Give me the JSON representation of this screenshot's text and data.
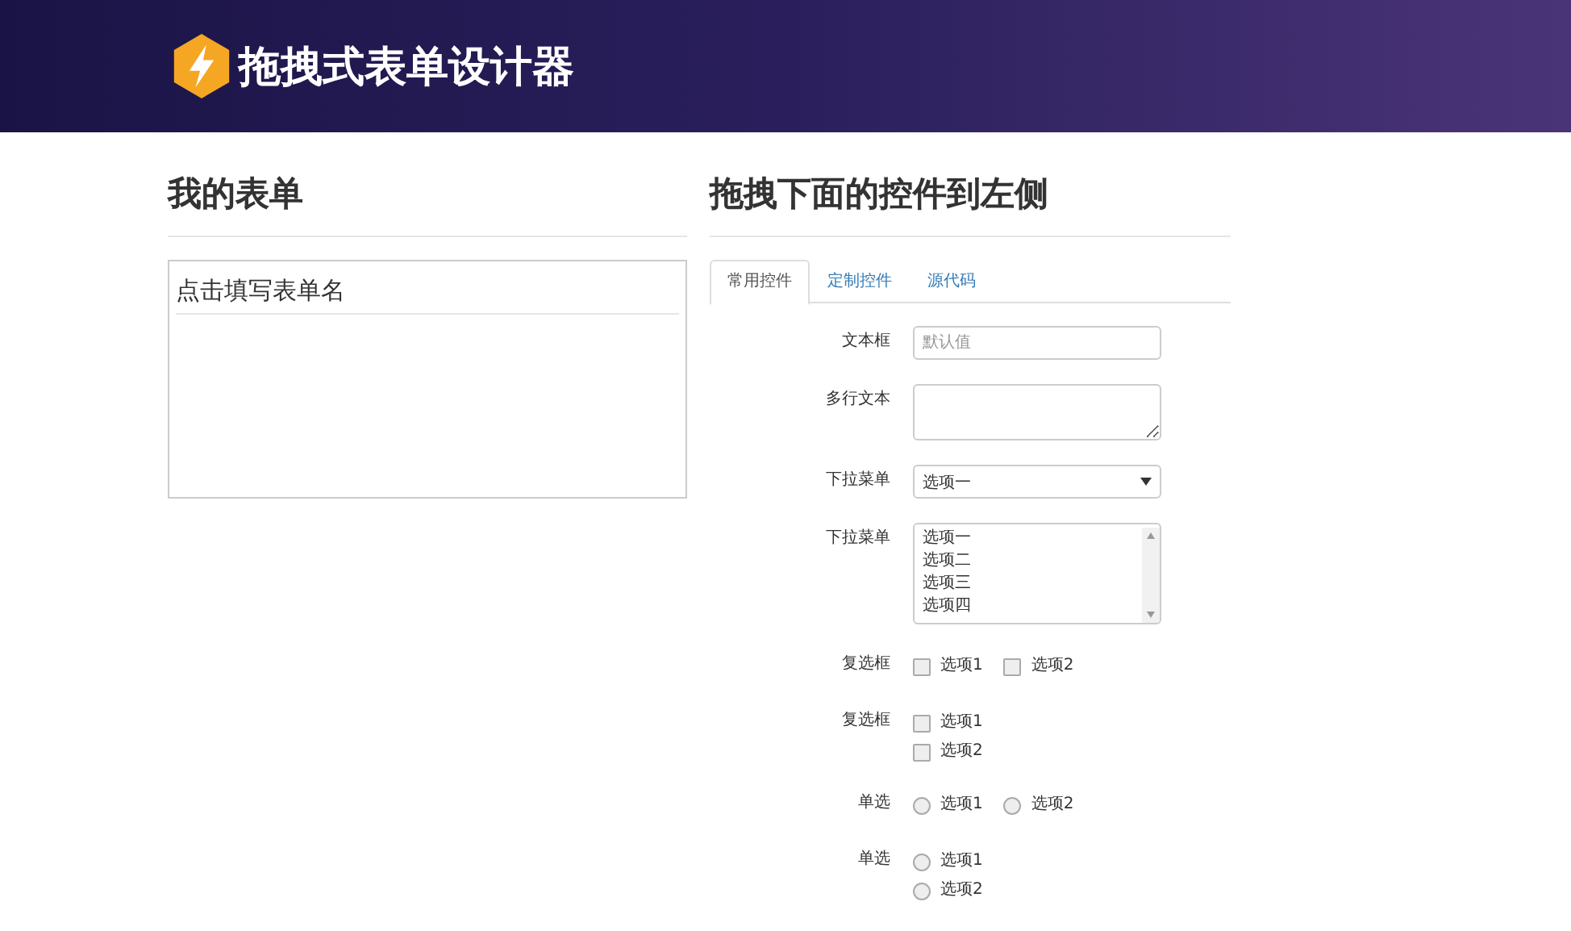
{
  "header": {
    "title": "拖拽式表单设计器"
  },
  "form_panel": {
    "heading": "我的表单",
    "form_name": "点击填写表单名"
  },
  "controls_panel": {
    "heading": "拖拽下面的控件到左侧",
    "tabs": [
      {
        "label": "常用控件",
        "selected": true
      },
      {
        "label": "定制控件",
        "selected": false
      },
      {
        "label": "源代码",
        "selected": false
      }
    ],
    "fields": [
      {
        "kind": "text",
        "label": "文本框",
        "placeholder": "默认值"
      },
      {
        "kind": "textarea",
        "label": "多行文本"
      },
      {
        "kind": "select",
        "label": "下拉菜单",
        "value": "选项一"
      },
      {
        "kind": "listbox",
        "label": "下拉菜单",
        "options": [
          "选项一",
          "选项二",
          "选项三",
          "选项四"
        ]
      },
      {
        "kind": "checkbox",
        "inline": true,
        "label": "复选框",
        "options": [
          {
            "label": "选项1",
            "checked": false
          },
          {
            "label": "选项2",
            "checked": false
          }
        ]
      },
      {
        "kind": "checkbox",
        "inline": false,
        "label": "复选框",
        "options": [
          {
            "label": "选项1",
            "checked": false
          },
          {
            "label": "选项2",
            "checked": false
          }
        ]
      },
      {
        "kind": "radio",
        "inline": true,
        "label": "单选",
        "options": [
          {
            "label": "选项1",
            "selected": false
          },
          {
            "label": "选项2",
            "selected": false
          }
        ]
      },
      {
        "kind": "radio",
        "inline": false,
        "label": "单选",
        "options": [
          {
            "label": "选项1",
            "selected": false
          },
          {
            "label": "选项2",
            "selected": false
          }
        ]
      }
    ]
  }
}
